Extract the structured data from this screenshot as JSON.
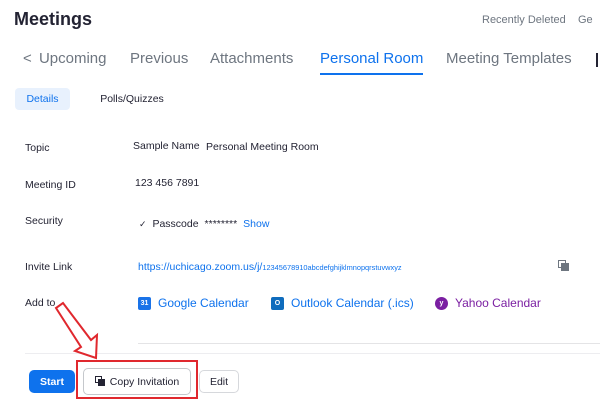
{
  "header": {
    "title": "Meetings",
    "recently_deleted": "Recently Deleted",
    "truncated_link": "Ge"
  },
  "tabs": [
    {
      "label": "Upcoming",
      "icon": "chevron-left-icon"
    },
    {
      "label": "Previous"
    },
    {
      "label": "Attachments"
    },
    {
      "label": "Personal Room",
      "active": true
    },
    {
      "label": "Meeting Templates"
    }
  ],
  "subtabs": {
    "details": "Details",
    "polls": "Polls/Quizzes"
  },
  "fields": {
    "topic_label": "Topic",
    "topic_name": "Sample Name",
    "topic_value": "Personal Meeting Room",
    "meeting_id_label": "Meeting ID",
    "meeting_id_value": "123 456 7891",
    "security_label": "Security",
    "security_check": "✓",
    "passcode_label": "Passcode",
    "passcode_value": "********",
    "show_link": "Show",
    "invite_label": "Invite Link",
    "invite_link_main": "https://uchicago.zoom.us/j/",
    "invite_link_tail": "12345678910abcdefghijklmnopqrstuvwxyz",
    "add_to_label": "Add to"
  },
  "calendars": [
    {
      "label": "Google Calendar",
      "icon": "google-calendar-icon",
      "glyph": "31"
    },
    {
      "label": "Outlook Calendar (.ics)",
      "icon": "outlook-icon",
      "glyph": "O"
    },
    {
      "label": "Yahoo Calendar",
      "icon": "yahoo-icon",
      "glyph": "y"
    }
  ],
  "actions": {
    "start": "Start",
    "copy_invitation": "Copy Invitation",
    "edit": "Edit"
  },
  "colors": {
    "accent": "#0e72ed",
    "annotation": "#e0282e",
    "yahoo": "#7b1fa2"
  }
}
